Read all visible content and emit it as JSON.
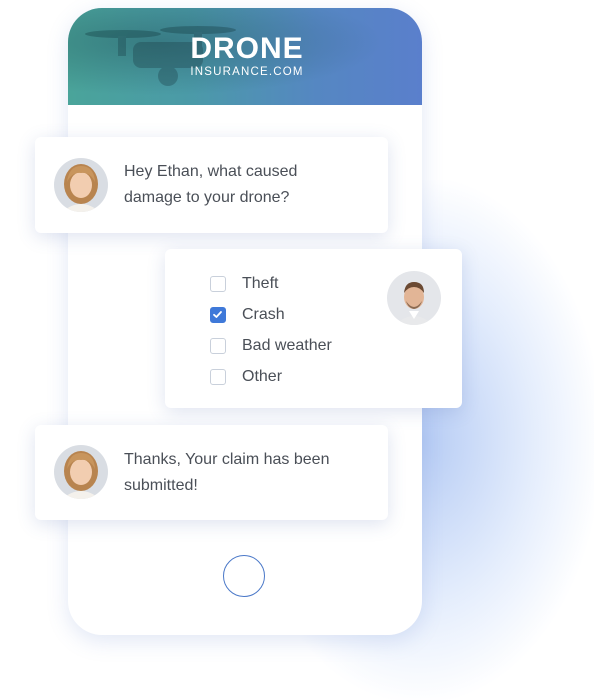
{
  "brand": {
    "main": "DRONE",
    "sub": "INSURANCE.COM"
  },
  "messages": [
    {
      "lines": [
        "Hey Ethan, what caused",
        "damage to your drone?"
      ],
      "sender": "agent"
    },
    {
      "lines": [
        "Thanks, Your claim has been",
        "submitted!"
      ],
      "sender": "agent"
    }
  ],
  "options": [
    {
      "label": "Theft",
      "checked": false
    },
    {
      "label": "Crash",
      "checked": true
    },
    {
      "label": "Bad weather",
      "checked": false
    },
    {
      "label": "Other",
      "checked": false
    }
  ],
  "colors": {
    "accent": "#3f79d9",
    "banner_start": "#4aa49a",
    "banner_end": "#5a7fcc",
    "text": "#4a4f57"
  },
  "icons": {
    "agent_avatar": "avatar-woman-icon",
    "user_avatar": "avatar-man-icon",
    "check": "check-icon"
  }
}
